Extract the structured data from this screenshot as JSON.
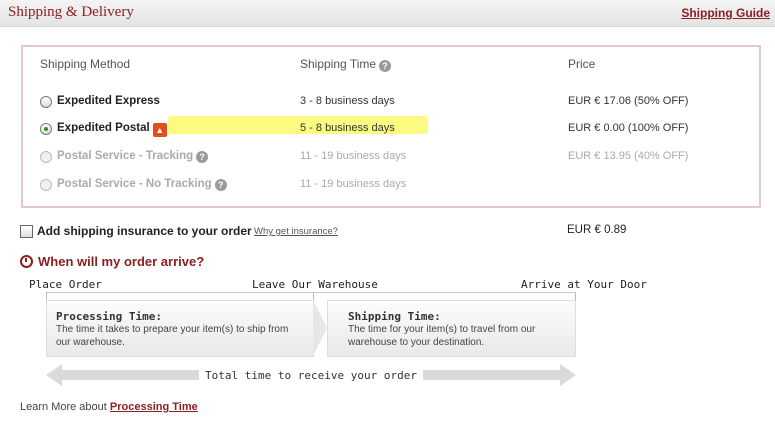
{
  "header": {
    "title": "Shipping & Delivery",
    "guide_link": "Shipping Guide"
  },
  "columns": {
    "method": "Shipping Method",
    "time": "Shipping Time",
    "price": "Price"
  },
  "methods": [
    {
      "name": "Expedited Express",
      "time": "3 - 8 business days",
      "price": "EUR € 17.06 (50% OFF)",
      "selected": false,
      "disabled": false
    },
    {
      "name": "Expedited Postal",
      "time": "5 - 8 business days",
      "price": "EUR € 0.00 (100% OFF)",
      "selected": true,
      "disabled": false
    },
    {
      "name": "Postal Service - Tracking",
      "time": "11 - 19 business days",
      "price": "EUR € 13.95 (40% OFF)",
      "selected": false,
      "disabled": true
    },
    {
      "name": "Postal Service - No Tracking",
      "time": "11 - 19 business days",
      "price": "",
      "selected": false,
      "disabled": true
    }
  ],
  "insurance": {
    "label": "Add shipping insurance to your order",
    "why_link": "Why get insurance?",
    "price": "EUR € 0.89",
    "checked": false
  },
  "arrival": {
    "heading": "When will my order arrive?",
    "labels": {
      "place": "Place Order",
      "leave": "Leave Our Warehouse",
      "arrive": "Arrive at Your Door"
    },
    "processing": {
      "title": "Processing Time:",
      "desc": "The time it takes to prepare your item(s) to ship from our warehouse."
    },
    "shipping": {
      "title": "Shipping Time:",
      "desc": "The time  for your item(s) to travel from our warehouse to your destination."
    },
    "total": "Total time to receive your order"
  },
  "learn_more": {
    "prefix": "Learn More about",
    "link": "Processing Time"
  },
  "colors": {
    "brand": "#8b1f23",
    "highlight": "#fbfb7a"
  }
}
